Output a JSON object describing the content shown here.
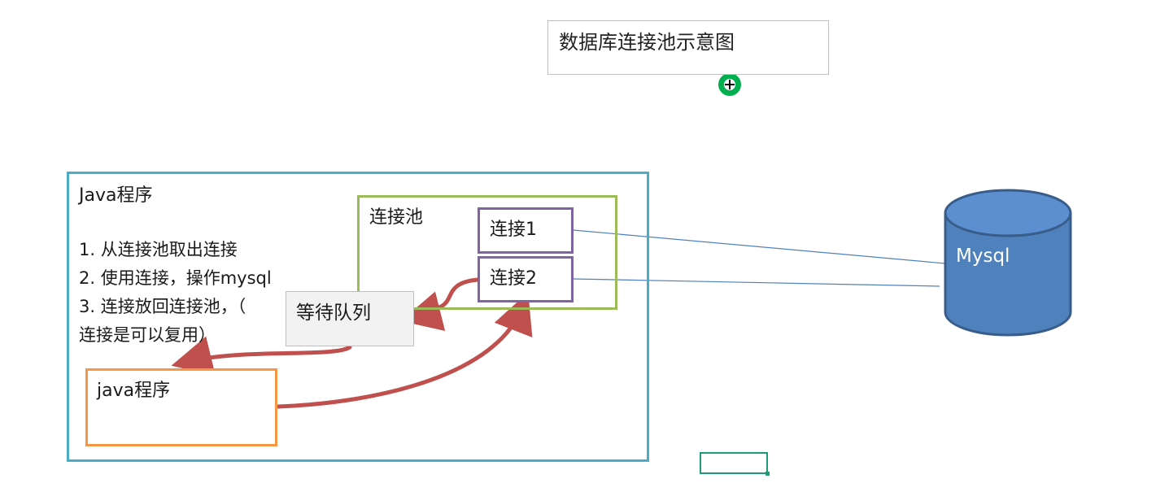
{
  "title": "数据库连接池示意图",
  "java_program": {
    "title": "Java程序",
    "steps": [
      "1. 从连接池取出连接",
      "2. 使用连接，操作mysql",
      "3. 连接放回连接池，（",
      "连接是可以复用）"
    ]
  },
  "pool": {
    "label": "连接池",
    "connections": [
      "连接1",
      "连接2"
    ]
  },
  "wait_queue": {
    "label": "等待队列"
  },
  "inner_program": {
    "label": "java程序"
  },
  "database": {
    "label": "Mysql"
  },
  "colors": {
    "outer_border": "#4bacc6",
    "pool_border": "#9bbb59",
    "connection_border": "#8064a2",
    "inner_border": "#f79646",
    "arrow": "#c0504d",
    "db_fill": "#4f81bd",
    "db_stroke": "#385d8a",
    "link_line": "#4f81bd"
  }
}
